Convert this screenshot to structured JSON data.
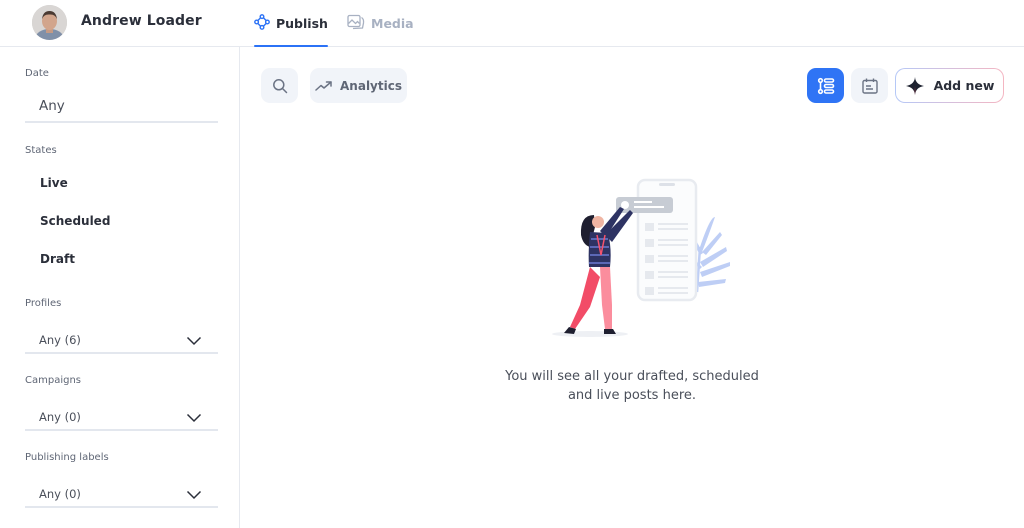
{
  "header": {
    "user_name": "Andrew Loader",
    "tabs": [
      {
        "label": "Publish",
        "icon": "publish-icon",
        "active": true
      },
      {
        "label": "Media",
        "icon": "media-icon",
        "active": false
      }
    ],
    "accent_color": "#2b72f6"
  },
  "sidebar": {
    "date": {
      "label": "Date",
      "value": "Any"
    },
    "states": {
      "label": "States",
      "items": [
        "Live",
        "Scheduled",
        "Draft"
      ]
    },
    "profiles": {
      "label": "Profiles",
      "value": "Any (6)"
    },
    "campaigns": {
      "label": "Campaigns",
      "value": "Any (0)"
    },
    "publishing_labels": {
      "label": "Publishing labels",
      "value": "Any (0)"
    }
  },
  "toolbar": {
    "search_icon": "search-icon",
    "analytics_label": "Analytics",
    "list_view_icon": "list-view-icon",
    "calendar_view_icon": "calendar-icon",
    "add_new_label": "Add new",
    "active_view_color": "#2f74f5"
  },
  "empty_state": {
    "line1": "You will see all your drafted, scheduled",
    "line2": "and live posts here."
  }
}
